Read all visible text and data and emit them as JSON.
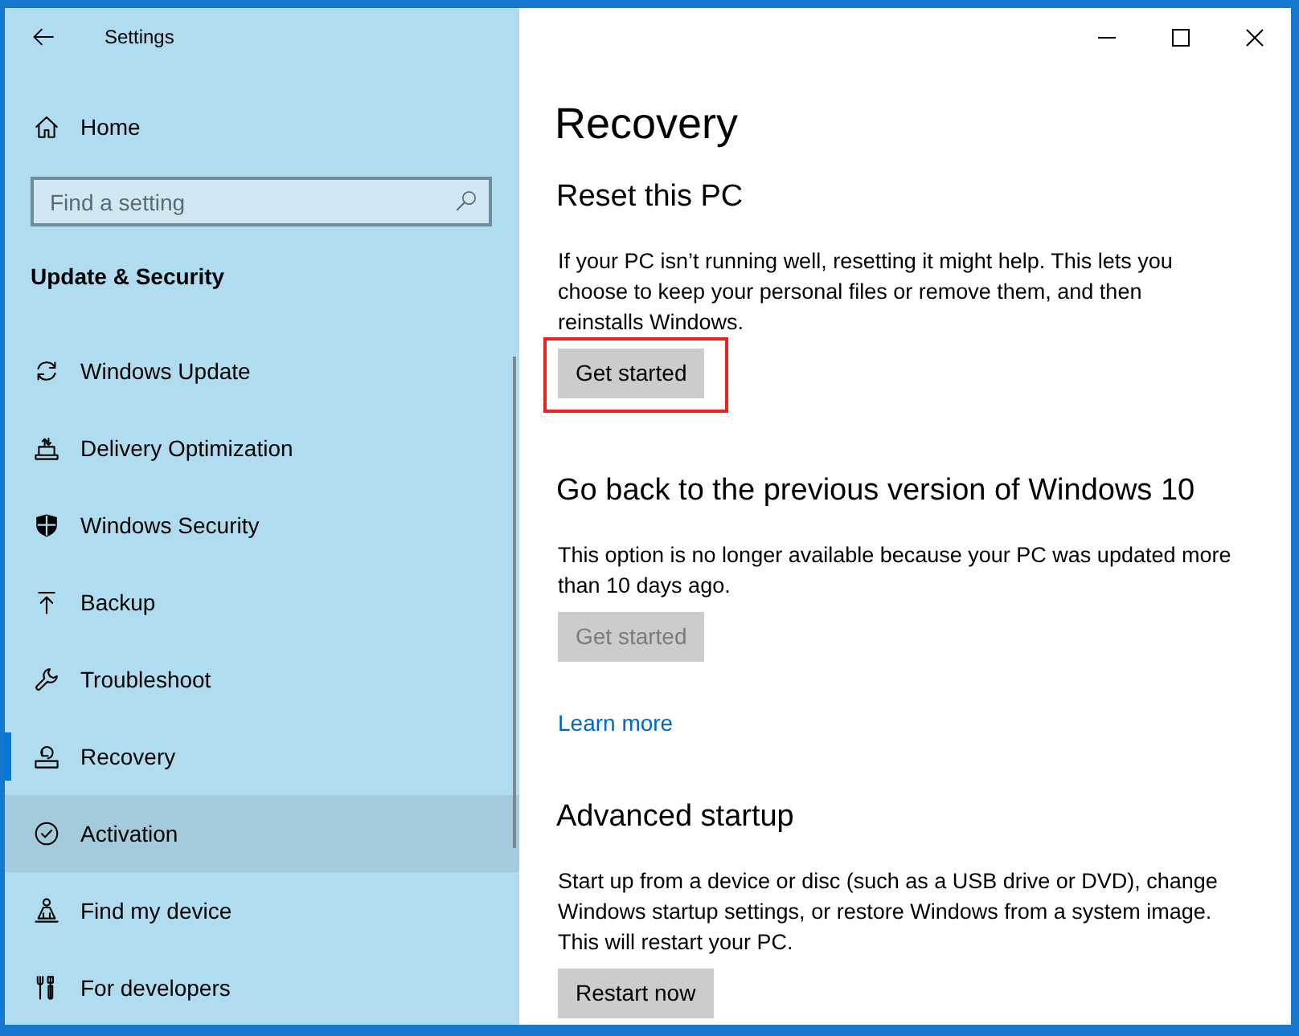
{
  "window": {
    "title": "Settings"
  },
  "sidebar": {
    "home": "Home",
    "search": {
      "placeholder": "Find a setting"
    },
    "section_title": "Update & Security",
    "items": [
      {
        "label": "Windows Update",
        "selected": false,
        "hovered": false
      },
      {
        "label": "Delivery Optimization",
        "selected": false,
        "hovered": false
      },
      {
        "label": "Windows Security",
        "selected": false,
        "hovered": false
      },
      {
        "label": "Backup",
        "selected": false,
        "hovered": false
      },
      {
        "label": "Troubleshoot",
        "selected": false,
        "hovered": false
      },
      {
        "label": "Recovery",
        "selected": true,
        "hovered": false
      },
      {
        "label": "Activation",
        "selected": false,
        "hovered": true
      },
      {
        "label": "Find my device",
        "selected": false,
        "hovered": false
      },
      {
        "label": "For developers",
        "selected": false,
        "hovered": false
      }
    ]
  },
  "page": {
    "title": "Recovery",
    "sections": [
      {
        "heading": "Reset this PC",
        "text": "If your PC isn’t running well, resetting it might help. This lets you choose to keep your personal files or remove them, and then reinstalls Windows.",
        "button": {
          "label": "Get started",
          "disabled": false,
          "highlighted": true
        }
      },
      {
        "heading": "Go back to the previous version of Windows 10",
        "text": "This option is no longer available because your PC was updated more than 10 days ago.",
        "button": {
          "label": "Get started",
          "disabled": true,
          "highlighted": false
        },
        "link": "Learn more"
      },
      {
        "heading": "Advanced startup",
        "text": "Start up from a device or disc (such as a USB drive or DVD), change Windows startup settings, or restore Windows from a system image. This will restart your PC.",
        "button": {
          "label": "Restart now",
          "disabled": false,
          "highlighted": false
        }
      }
    ]
  }
}
